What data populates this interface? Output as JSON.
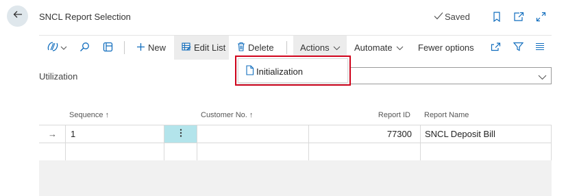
{
  "header": {
    "title": "SNCL Report Selection",
    "saved_label": "Saved"
  },
  "toolbar": {
    "new_label": "New",
    "edit_list_label": "Edit List",
    "delete_label": "Delete",
    "actions_label": "Actions",
    "automate_label": "Automate",
    "fewer_options_label": "Fewer options"
  },
  "actions_menu": {
    "items": [
      {
        "label": "Initialization"
      }
    ]
  },
  "usage_field": {
    "label": "Utilization",
    "value": ""
  },
  "table": {
    "columns": [
      {
        "label": "Sequence ↑"
      },
      {
        "label": "Customer No. ↑"
      },
      {
        "label": "Report ID"
      },
      {
        "label": "Report Name"
      }
    ],
    "rows": [
      {
        "indicator": "→",
        "sequence": "1",
        "customer_no": "",
        "report_id": "77300",
        "report_name": "SNCL Deposit Bill"
      },
      {
        "indicator": "",
        "sequence": "",
        "customer_no": "",
        "report_id": "",
        "report_name": ""
      }
    ]
  },
  "colors": {
    "accent": "#0f6cbd",
    "selected_cell": "#b3e4eb",
    "highlight_border": "#d0021b"
  }
}
